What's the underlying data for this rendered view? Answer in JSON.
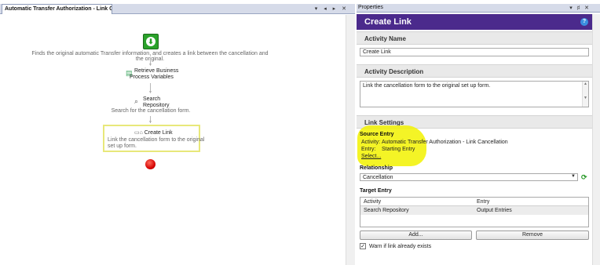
{
  "designer": {
    "tab_title": "Automatic Transfer Authorization - Link C...",
    "tab_controls": "▾ ◂ ▸ ✕",
    "step1_description": "Finds the original automatic Transfer information, and creates a link between the cancellation and the original.",
    "step2_label_line1": "Retrieve Business",
    "step2_label_line2": "Process Variables",
    "step3_label_line1": "Search",
    "step3_label_line2": "Repository",
    "step3_description": "Search for the cancellation form.",
    "step4_label": "Create Link",
    "step4_description_line1": "Link the cancellation form to the original",
    "step4_description_line2": "set up form."
  },
  "properties": {
    "panel_title": "Properties",
    "panel_controls": "▾ ♯ ✕",
    "header_title": "Create Link",
    "help_icon": "?",
    "activity_name_section": "Activity Name",
    "activity_name_value": "Create Link",
    "activity_description_section": "Activity Description",
    "activity_description_value": "Link the cancellation form to the original set up form.",
    "link_settings_section": "Link Settings",
    "source_entry_label": "Source Entry",
    "source_activity_key": "Activity:",
    "source_activity_value": "Automatic Transfer Authorization - Link Cancellation",
    "source_entry_key": "Entry:",
    "source_entry_value": "Starting Entry",
    "select_link": "Select...",
    "relationship_label": "Relationship",
    "relationship_value": "Cancellation",
    "target_entry_label": "Target Entry",
    "target_columns": [
      "Activity",
      "Entry"
    ],
    "target_rows": [
      {
        "activity": "Search Repository",
        "entry": "Output Entries"
      }
    ],
    "add_button": "Add...",
    "remove_button": "Remove",
    "warn_checkbox_label": "Warn if link already exists",
    "warn_checked": true
  },
  "colors": {
    "header_purple": "#4b2a8c",
    "start_green": "#2aa22a",
    "end_red": "#d40000",
    "highlight_yellow": "#f2f200",
    "selection_border": "#e8e87a"
  }
}
